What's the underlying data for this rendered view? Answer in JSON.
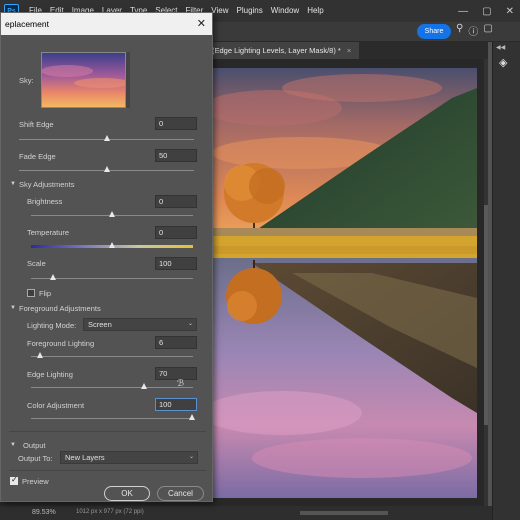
{
  "app": {
    "logo": "Ps"
  },
  "menu": [
    "File",
    "Edit",
    "Image",
    "Layer",
    "Type",
    "Select",
    "Filter",
    "View",
    "Plugins",
    "Window",
    "Help"
  ],
  "window_controls": {
    "minimize": "—",
    "maximize": "▢",
    "close": "✕"
  },
  "options_bar": {
    "share_label": "Share",
    "icons": [
      "search-icon",
      "help-icon",
      "workspace-icon"
    ]
  },
  "document": {
    "tab_title": "(Edge Lighting Levels, Layer Mask/8) *",
    "tab_close": "×"
  },
  "status": {
    "zoom": "89.53%",
    "doc_size": "1012 px x 977 px (72 ppi)"
  },
  "dialog": {
    "title": "eplacement",
    "close": "✕",
    "sky_label": "Sky:",
    "shift_edge": {
      "label": "Shift Edge",
      "value": "0"
    },
    "fade_edge": {
      "label": "Fade Edge",
      "value": "50"
    },
    "sky_adjustments": {
      "header": "Sky Adjustments",
      "brightness": {
        "label": "Brightness",
        "value": "0"
      },
      "temperature": {
        "label": "Temperature",
        "value": "0"
      },
      "scale": {
        "label": "Scale",
        "value": "100"
      },
      "flip_label": "Flip",
      "flip_checked": false
    },
    "foreground_adjustments": {
      "header": "Foreground Adjustments",
      "lighting_mode_label": "Lighting Mode:",
      "lighting_mode_value": "Screen",
      "foreground_lighting": {
        "label": "Foreground Lighting",
        "value": "6"
      },
      "edge_lighting": {
        "label": "Edge Lighting",
        "value": "70"
      },
      "color_adjustment": {
        "label": "Color Adjustment",
        "value": "100"
      }
    },
    "output": {
      "header": "Output",
      "output_to_label": "Output To:",
      "output_to_value": "New Layers"
    },
    "preview": {
      "label": "Preview",
      "checked": true
    },
    "ok_label": "OK",
    "cancel_label": "Cancel"
  },
  "colors": {
    "accent": "#1473e6",
    "panel": "#535353",
    "title_bar": "#f0f0f0"
  }
}
